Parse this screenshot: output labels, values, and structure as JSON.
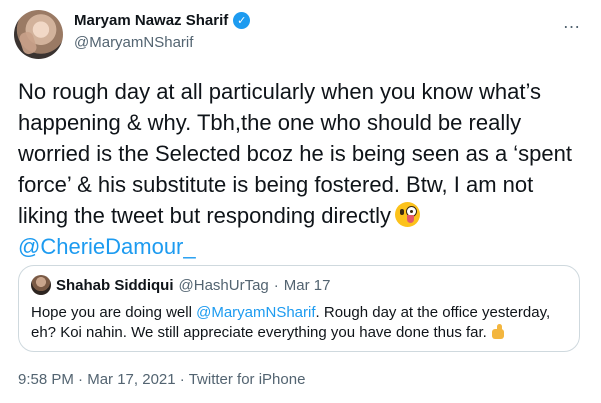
{
  "author": {
    "display_name": "Maryam Nawaz Sharif",
    "handle": "@MaryamNSharif",
    "verified_mark": "✓"
  },
  "more_icon": "…",
  "tweet": {
    "text_before": "No rough day at all particularly when you know what’s happening & why. Tbh,the one who should be really worried is the Selected bcoz he is being seen as a ‘spent force’ & his substitute is being fostered. Btw, I am not liking the tweet but responding directly",
    "emoji": "winking-face-with-tongue",
    "mention": "@CherieDamour_"
  },
  "quoted_tweet": {
    "display_name": "Shahab Siddiqui",
    "handle": "@HashUrTag",
    "separator": "·",
    "date": "Mar 17",
    "text_before_mention": "Hope you are doing well ",
    "mention": "@MaryamNSharif",
    "text_after_mention": ". Rough day at the office yesterday, eh? Koi nahin. We still appreciate everything you have done thus far.",
    "emoji": "thumbs-up"
  },
  "footer": {
    "time": "9:58 PM",
    "separator": "·",
    "date": "Mar 17, 2021",
    "source": "Twitter for iPhone"
  },
  "colors": {
    "accent": "#1d9bf0",
    "secondary_text": "#536471",
    "border": "#cfd9de"
  }
}
